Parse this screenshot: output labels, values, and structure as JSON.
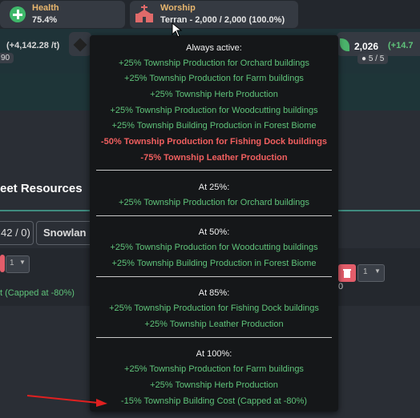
{
  "top": {
    "health": {
      "label": "Health",
      "value": "75.4%"
    },
    "worship": {
      "label": "Worship",
      "value": "Terran - 2,000 / 2,000 (100.0%)"
    }
  },
  "bar2": {
    "gold_rate": "(+4,142.28 /t)",
    "badge_left": "90",
    "pop": "2,026",
    "pop_rate": "(+14.7",
    "badge_right": "5 / 5"
  },
  "section": {
    "title": "eet Resources",
    "btn_left": "42 / 0)",
    "btn_biome": "Snowlan",
    "select_val": "1",
    "select_val_right": "1",
    "capped_text": "t (Capped at -80%)",
    "right_small": "0"
  },
  "tooltip": {
    "h_always": "Always active:",
    "always": [
      {
        "text": "+25% Township Production for Orchard buildings",
        "cls": "green"
      },
      {
        "text": "+25% Township Production for Farm buildings",
        "cls": "green"
      },
      {
        "text": "+25% Township Herb Production",
        "cls": "green"
      },
      {
        "text": "+25% Township Production for Woodcutting buildings",
        "cls": "green"
      },
      {
        "text": "+25% Township Building Production in Forest Biome",
        "cls": "green"
      },
      {
        "text": "-50% Township Production for Fishing Dock buildings",
        "cls": "red"
      },
      {
        "text": "-75% Township Leather Production",
        "cls": "red"
      }
    ],
    "h25": "At 25%:",
    "at25": [
      "+25% Township Production for Orchard buildings"
    ],
    "h50": "At 50%:",
    "at50": [
      "+25% Township Production for Woodcutting buildings",
      "+25% Township Building Production in Forest Biome"
    ],
    "h85": "At 85%:",
    "at85": [
      "+25% Township Production for Fishing Dock buildings",
      "+25% Township Leather Production"
    ],
    "h100": "At 100%:",
    "at100": [
      "+25% Township Production for Farm buildings",
      "+25% Township Herb Production",
      "-15% Township Building Cost (Capped at -80%)"
    ]
  },
  "colors": {
    "green": "#5fc37a",
    "red": "#f05f5f",
    "accent": "#3f8b7f",
    "health_label": "#e8b66e"
  }
}
